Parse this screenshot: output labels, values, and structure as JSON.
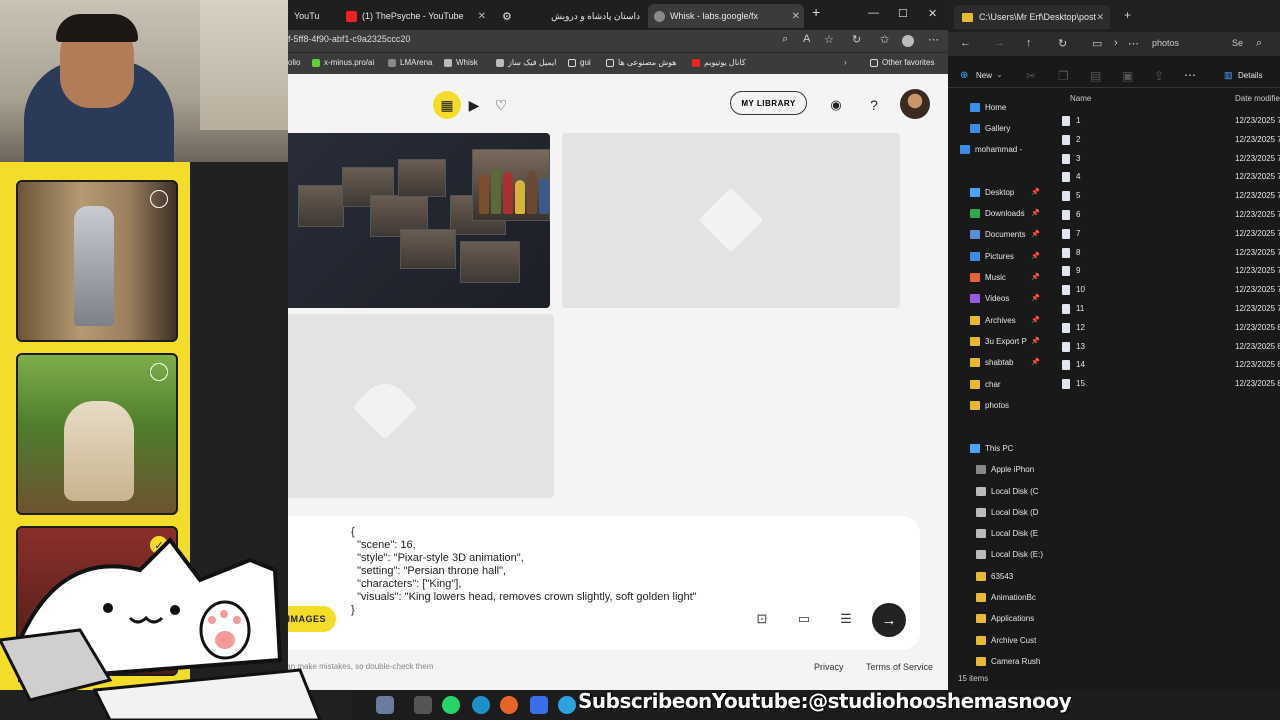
{
  "browser": {
    "tabs": [
      {
        "label": "YouTub"
      },
      {
        "label": "(1) ThePsyche - YouTube"
      },
      {
        "label": ""
      },
      {
        "label": "داستان پادشاه و درویش"
      },
      {
        "label": "Whisk - labs.google/fx"
      }
    ],
    "new_tab": "+",
    "url": "f-5ff8-4f90-abf1-c9a2325ccc20",
    "favorites": [
      {
        "label": "olio"
      },
      {
        "label": "x-minus.pro/ai"
      },
      {
        "label": "LMArena"
      },
      {
        "label": "Whisk"
      },
      {
        "label": "ایمیل فیک ساز"
      },
      {
        "label": "gui"
      },
      {
        "label": "هوش مصنوعی ها"
      },
      {
        "label": "کانال یوتیوبم"
      },
      {
        "label": "Other favorites"
      }
    ]
  },
  "whisk": {
    "my_library": "MY LIBRARY",
    "prompt_text": "{\n  \"scene\": 16,\n  \"style\": \"Pixar-style 3D animation\",\n  \"setting\": \"Persian throne hall\",\n  \"characters\": [\"King\"],\n  \"visuals\": \"King lowers head, removes crown slightly, soft golden light\"\n}",
    "images_button": "DE IMAGES",
    "footer_note": "s can make mistakes, so double-check them",
    "privacy": "Privacy",
    "terms": "Terms of Service",
    "accent_color": "#f4dc2a"
  },
  "overlay": {
    "subscribe_text": "SubscribeonYoutube:@studiohooshemasnooy"
  },
  "explorer": {
    "tab_title": "C:\\Users\\Mr Erf\\Desktop\\post",
    "breadcrumb": "photos",
    "search_hint": "Se",
    "new_label": "New",
    "details_label": "Details",
    "columns": {
      "name": "Name",
      "date": "Date modifie"
    },
    "nav": [
      {
        "label": "Home"
      },
      {
        "label": "Gallery"
      },
      {
        "label": "mohammad -"
      },
      {
        "label": "Desktop"
      },
      {
        "label": "Downloads"
      },
      {
        "label": "Documents"
      },
      {
        "label": "Pictures"
      },
      {
        "label": "Music"
      },
      {
        "label": "Videos"
      },
      {
        "label": "Archives"
      },
      {
        "label": "3u Export P"
      },
      {
        "label": "shabtab"
      },
      {
        "label": "char"
      },
      {
        "label": "photos"
      },
      {
        "label": "This PC"
      },
      {
        "label": "Apple iPhon"
      },
      {
        "label": "Local Disk (C"
      },
      {
        "label": "Local Disk (D"
      },
      {
        "label": "Local Disk (E"
      },
      {
        "label": "Local Disk (E:)"
      },
      {
        "label": "63543"
      },
      {
        "label": "AnimationBc"
      },
      {
        "label": "Applications"
      },
      {
        "label": "Archive Cust"
      },
      {
        "label": "Camera Rush"
      }
    ],
    "files": [
      {
        "name": "1",
        "date": "12/23/2025 7"
      },
      {
        "name": "2",
        "date": "12/23/2025 7"
      },
      {
        "name": "3",
        "date": "12/23/2025 7"
      },
      {
        "name": "4",
        "date": "12/23/2025 7"
      },
      {
        "name": "5",
        "date": "12/23/2025 7"
      },
      {
        "name": "6",
        "date": "12/23/2025 7"
      },
      {
        "name": "7",
        "date": "12/23/2025 7"
      },
      {
        "name": "8",
        "date": "12/23/2025 7"
      },
      {
        "name": "9",
        "date": "12/23/2025 7"
      },
      {
        "name": "10",
        "date": "12/23/2025 7"
      },
      {
        "name": "11",
        "date": "12/23/2025 7"
      },
      {
        "name": "12",
        "date": "12/23/2025 8"
      },
      {
        "name": "13",
        "date": "12/23/2025 8"
      },
      {
        "name": "14",
        "date": "12/23/2025 8"
      },
      {
        "name": "15",
        "date": "12/23/2025 8"
      }
    ],
    "status": "15 items"
  }
}
